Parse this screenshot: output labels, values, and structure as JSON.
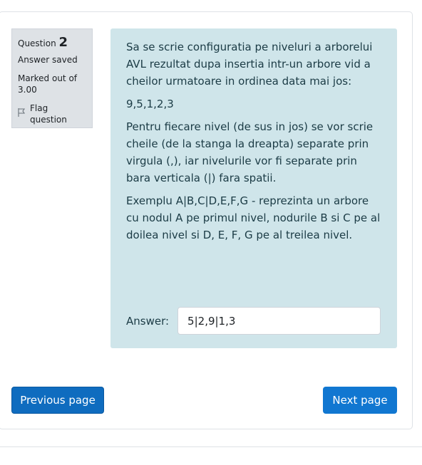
{
  "question_info": {
    "label": "Question",
    "number": "2",
    "state": "Answer saved",
    "grade": "Marked out of 3.00",
    "flag_label": "Flag question"
  },
  "question": {
    "paragraphs": [
      "Sa se scrie configuratia pe niveluri a arborelui AVL rezultat dupa insertia intr-un arbore vid a cheilor urmatoare in ordinea data mai jos:",
      "9,5,1,2,3",
      "Pentru fiecare nivel (de sus in jos) se vor scrie cheile (de la stanga la dreapta) separate prin virgula (,), iar nivelurile vor fi separate prin bara verticala (|) fara spatii.",
      "Exemplu A|B,C|D,E,F,G - reprezinta un arbore cu nodul A pe primul nivel, nodurile B si C pe al doilea nivel si D, E, F, G pe al treilea nivel."
    ],
    "answer_label": "Answer:",
    "answer_value": "5|2,9|1,3"
  },
  "navigation": {
    "previous_label": "Previous page",
    "next_label": "Next page"
  },
  "colors": {
    "content_bg": "#cfe5ea",
    "info_bg": "#dee2e6",
    "primary": "#0f6cbf"
  }
}
